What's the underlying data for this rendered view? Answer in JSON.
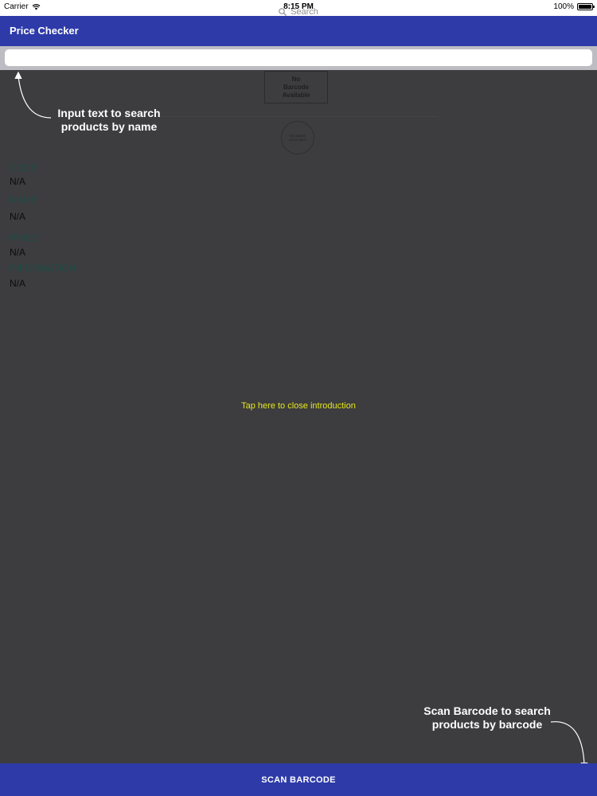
{
  "status_bar": {
    "carrier": "Carrier",
    "time": "8:15 PM",
    "battery": "100%",
    "battery_level": 1.0
  },
  "app_bar": {
    "title": "Price Checker"
  },
  "search": {
    "value": "",
    "placeholder": "Search"
  },
  "product": {
    "barcode_placeholder_lines": [
      "No",
      "Barcode",
      "Available"
    ],
    "image_placeholder_lines": [
      "NO IMAGE",
      "AVAILABLE"
    ],
    "fields": [
      {
        "label": "CODE",
        "value": "N/A"
      },
      {
        "label": "NAME",
        "value": "N/A"
      },
      {
        "label": "PRICE",
        "value": "N/A"
      },
      {
        "label": "INFORMATION",
        "value": "N/A"
      }
    ]
  },
  "intro": {
    "search_hint_line1": "Input text to search",
    "search_hint_line2": "products by name",
    "close_text": "Tap here to close introduction",
    "scan_hint_line1": "Scan Barcode to search",
    "scan_hint_line2": "products by barcode"
  },
  "bottom_button": {
    "label": "SCAN BARCODE"
  },
  "colors": {
    "primary": "#2d3aa8",
    "overlay": "#3d3c3f",
    "field_label": "#1d4d43",
    "close_text": "#e5e81e"
  },
  "icons": {
    "search": "search-icon",
    "wifi": "wifi-icon",
    "battery": "battery-icon",
    "hint_arrow_up": "curved-arrow-up-icon",
    "hint_arrow_down": "curved-arrow-down-icon"
  }
}
